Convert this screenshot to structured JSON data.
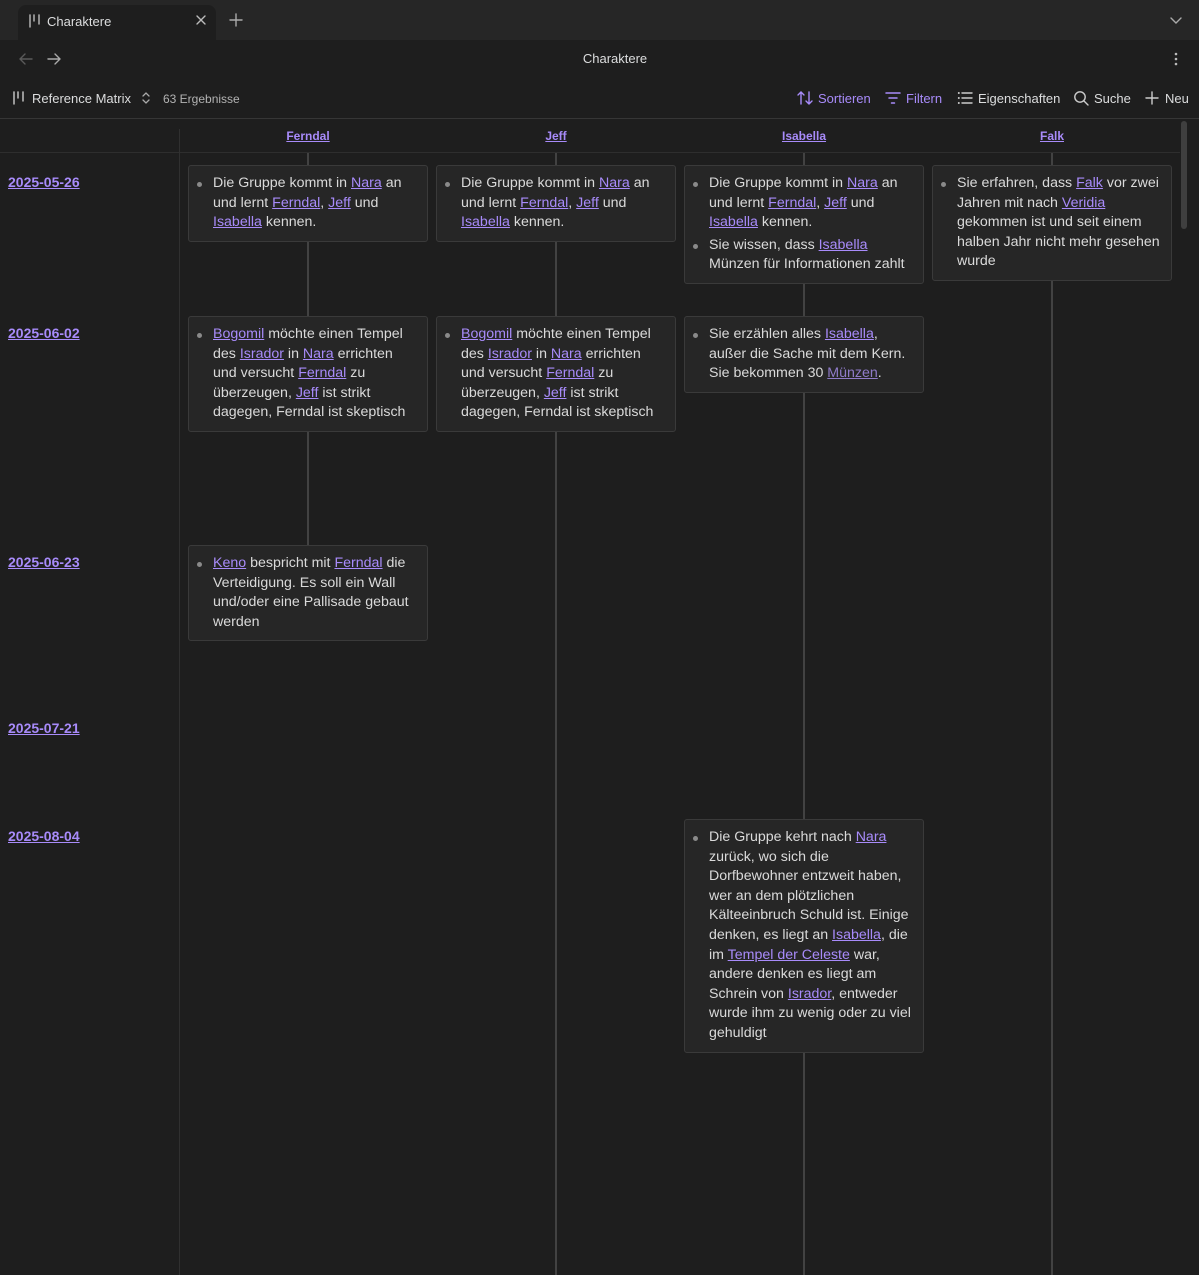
{
  "tab": {
    "title": "Charaktere"
  },
  "header": {
    "title": "Charaktere"
  },
  "toolbar": {
    "view_name": "Reference Matrix",
    "result_count": "63 Ergebnisse",
    "sort_label": "Sortieren",
    "filter_label": "Filtern",
    "properties_label": "Eigenschaften",
    "search_label": "Suche",
    "new_label": "Neu"
  },
  "accent_color": "#a88bfa",
  "icons": [
    "view-board-icon",
    "close-icon",
    "plus-icon",
    "chevron-down-icon",
    "arrow-left-icon",
    "arrow-right-icon",
    "more-vertical-icon",
    "chevrons-up-down-icon",
    "sort-icon",
    "filter-icon",
    "list-icon",
    "search-icon"
  ],
  "matrix": {
    "columns": [
      "Ferndal",
      "Jeff",
      "Isabella",
      "Falk"
    ],
    "dates": [
      "2025-05-26",
      "2025-06-02",
      "2025-06-23",
      "2025-07-21",
      "2025-08-04"
    ]
  },
  "cards": [
    {
      "column": 0,
      "date": 0,
      "items": [
        [
          {
            "t": "Die Gruppe kommt in "
          },
          {
            "l": "Nara"
          },
          {
            "t": " an und lernt "
          },
          {
            "l": "Ferndal"
          },
          {
            "t": ", "
          },
          {
            "l": "Jeff"
          },
          {
            "t": " und "
          },
          {
            "l": "Isabella"
          },
          {
            "t": " kennen."
          }
        ]
      ]
    },
    {
      "column": 1,
      "date": 0,
      "items": [
        [
          {
            "t": "Die Gruppe kommt in "
          },
          {
            "l": "Nara"
          },
          {
            "t": " an und lernt "
          },
          {
            "l": "Ferndal"
          },
          {
            "t": ", "
          },
          {
            "l": "Jeff"
          },
          {
            "t": " und "
          },
          {
            "l": "Isabella"
          },
          {
            "t": " kennen."
          }
        ]
      ]
    },
    {
      "column": 2,
      "date": 0,
      "items": [
        [
          {
            "t": "Die Gruppe kommt in "
          },
          {
            "l": "Nara"
          },
          {
            "t": " an und lernt "
          },
          {
            "l": "Ferndal"
          },
          {
            "t": ", "
          },
          {
            "l": "Jeff"
          },
          {
            "t": " und "
          },
          {
            "l": "Isabella"
          },
          {
            "t": " kennen."
          }
        ],
        [
          {
            "t": "Sie wissen, dass "
          },
          {
            "l": "Isabella"
          },
          {
            "t": " Münzen für Informationen zahlt"
          }
        ]
      ]
    },
    {
      "column": 3,
      "date": 0,
      "items": [
        [
          {
            "t": "Sie erfahren, dass "
          },
          {
            "l": "Falk"
          },
          {
            "t": " vor zwei Jahren mit nach "
          },
          {
            "l": "Veridia"
          },
          {
            "t": " gekommen ist und seit einem halben Jahr nicht mehr gesehen wurde"
          }
        ]
      ]
    },
    {
      "column": 0,
      "date": 1,
      "items": [
        [
          {
            "l": "Bogomil"
          },
          {
            "t": " möchte einen Tempel des "
          },
          {
            "l": "Isrador"
          },
          {
            "t": " in "
          },
          {
            "l": "Nara"
          },
          {
            "t": " errichten und versucht "
          },
          {
            "l": "Ferndal"
          },
          {
            "t": " zu überzeugen, "
          },
          {
            "l": "Jeff"
          },
          {
            "t": " ist strikt dagegen, Ferndal ist skeptisch"
          }
        ]
      ]
    },
    {
      "column": 1,
      "date": 1,
      "items": [
        [
          {
            "l": "Bogomil"
          },
          {
            "t": " möchte einen Tempel des "
          },
          {
            "l": "Isrador"
          },
          {
            "t": " in "
          },
          {
            "l": "Nara"
          },
          {
            "t": " errichten und versucht "
          },
          {
            "l": "Ferndal"
          },
          {
            "t": " zu überzeugen, "
          },
          {
            "l": "Jeff"
          },
          {
            "t": " ist strikt dagegen, Ferndal ist skeptisch"
          }
        ]
      ]
    },
    {
      "column": 2,
      "date": 1,
      "items": [
        [
          {
            "t": "Sie erzählen alles "
          },
          {
            "l": "Isabella"
          },
          {
            "t": ", außer die Sache mit dem Kern. Sie bekommen 30 "
          },
          {
            "u": "Münzen"
          },
          {
            "t": "."
          }
        ]
      ]
    },
    {
      "column": 0,
      "date": 2,
      "items": [
        [
          {
            "l": "Keno"
          },
          {
            "t": " bespricht mit "
          },
          {
            "l": "Ferndal"
          },
          {
            "t": " die Verteidigung. Es soll ein Wall und/oder eine Pallisade gebaut werden"
          }
        ]
      ]
    },
    {
      "column": 2,
      "date": 4,
      "items": [
        [
          {
            "t": "Die Gruppe kehrt nach "
          },
          {
            "l": "Nara"
          },
          {
            "t": " zurück, wo sich die Dorfbewohner entzweit haben, wer an dem plötzlichen Kälteeinbruch Schuld ist. Einige denken, es liegt an "
          },
          {
            "l": "Isabella"
          },
          {
            "t": ", die im "
          },
          {
            "l": "Tempel der Celeste"
          },
          {
            "t": " war, andere denken es liegt am Schrein von "
          },
          {
            "l": "Isrador"
          },
          {
            "t": ", entweder wurde ihm zu wenig oder zu viel gehuldigt"
          }
        ]
      ]
    }
  ]
}
